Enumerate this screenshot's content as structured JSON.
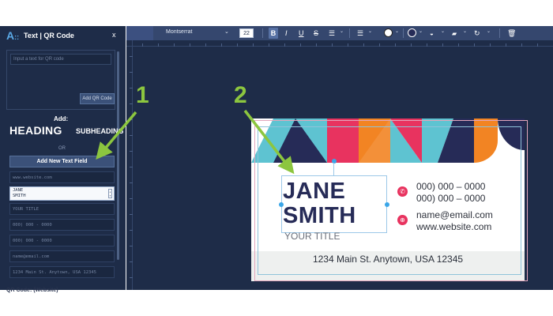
{
  "sidebar": {
    "title": "Text | QR Code",
    "close_label": "x",
    "qr": {
      "placeholder": "Input a text for QR code",
      "button_label": "Add QR Code"
    },
    "add_label": "Add:",
    "heading_label": "HEADING",
    "subheading_label": "SUBHEADING",
    "or_label": "OR",
    "add_field_label": "Add New Text Field",
    "fields": [
      {
        "value": "www.website.com"
      },
      {
        "value_line1": "JANE",
        "value_line2": "SMITH"
      },
      {
        "value": "YOUR TITLE"
      },
      {
        "value": "000) 000 - 0000"
      },
      {
        "value": "000) 000 - 0000"
      },
      {
        "value": "name@email.com"
      },
      {
        "value": "1234 Main St. Anytown, USA 12345"
      }
    ],
    "bottom_text": "QR Code: (Website)"
  },
  "toolbar": {
    "font": "Montserrat",
    "font_size": "22",
    "bold": "B",
    "italic": "I",
    "underline": "U",
    "strike": "S"
  },
  "card": {
    "name_line1": "JANE",
    "name_line2": "SMITH",
    "title": "YOUR TITLE",
    "phone1": "000) 000 – 0000",
    "phone2": "000) 000 – 0000",
    "email": "name@email.com",
    "website": "www.website.com",
    "address": "1234 Main St. Anytown, USA 12345"
  },
  "annotations": {
    "step1": "1",
    "step2": "2"
  },
  "colors": {
    "sidebar_bg": "#1e2c48",
    "toolbar_bg": "#35476e",
    "accent_green": "#8cc63f",
    "card_navy": "#262b57",
    "card_pink": "#e8335f",
    "card_teal": "#5ec3d1",
    "card_orange": "#f28423"
  },
  "icons": {
    "logo": "text-tool-logo-icon",
    "line_spacing": "line-spacing-icon",
    "align": "align-left-icon",
    "text_color": "text-color-icon",
    "highlight_color": "highlight-color-icon",
    "fill": "fill-drop-icon",
    "layer": "layer-order-icon",
    "rotate": "rotate-icon",
    "delete": "trash-icon",
    "phone": "phone-icon",
    "email": "globe-icon"
  }
}
